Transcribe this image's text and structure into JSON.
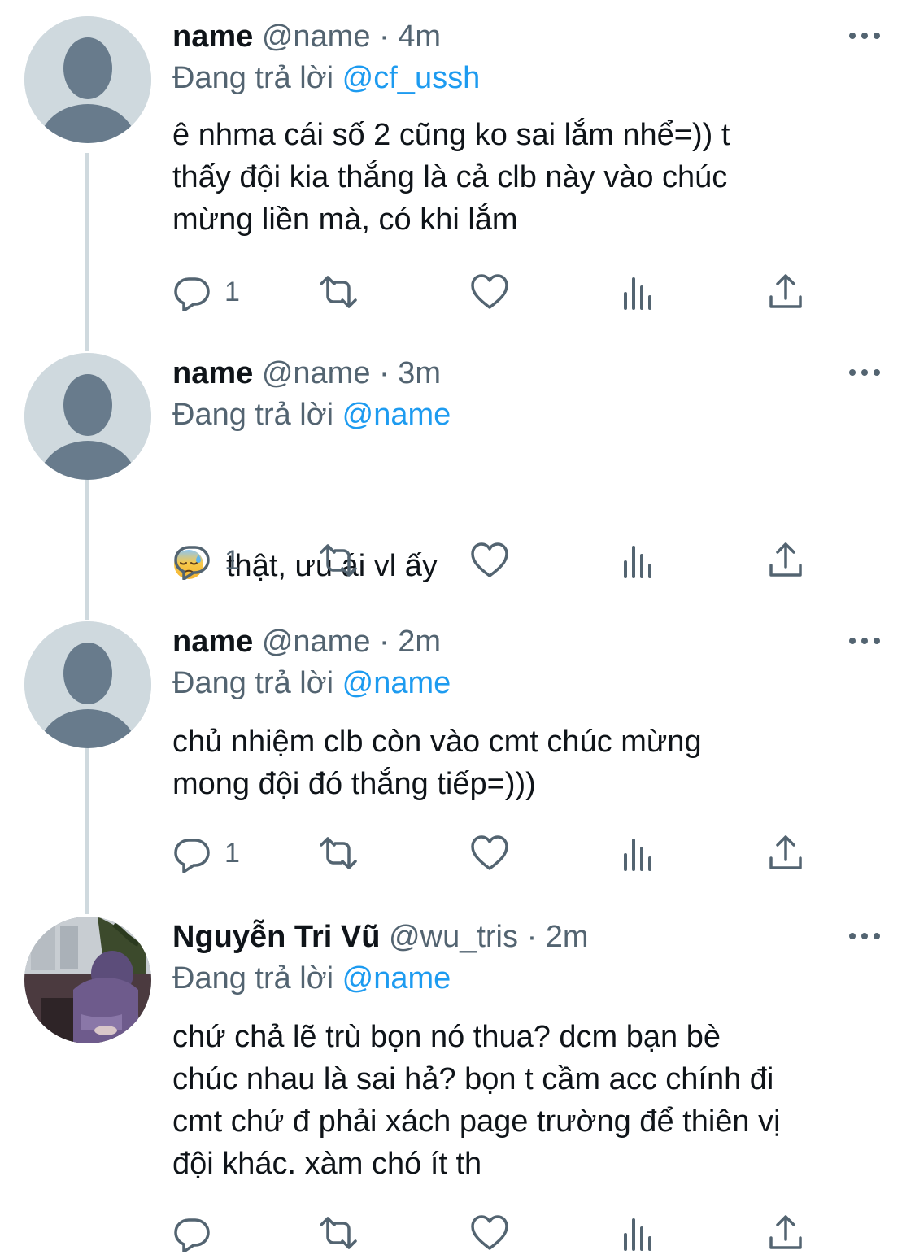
{
  "tweets": [
    {
      "display_name": "name",
      "handle": "@name",
      "separator": "·",
      "time": "4m",
      "reply_prefix": "Đang trả lời",
      "reply_to": "@cf_ussh",
      "text": "ê nhma cái số 2 cũng ko sai lắm nhể=)) t\nthấy đội kia thắng là cả clb này vào chúc\nmừng liền mà, có khi lắm",
      "reply_count": "1",
      "avatar": "default-avatar"
    },
    {
      "display_name": "name",
      "handle": "@name",
      "separator": "·",
      "time": "3m",
      "reply_prefix": "Đang trả lời",
      "reply_to": "@name",
      "emoji": "sweat-face-emoji",
      "text": "thật, ưu ái vl ấy",
      "reply_count": "1",
      "avatar": "default-avatar"
    },
    {
      "display_name": "name",
      "handle": "@name",
      "separator": "·",
      "time": "2m",
      "reply_prefix": "Đang trả lời",
      "reply_to": "@name",
      "text": "chủ nhiệm clb còn vào cmt chúc mừng\nmong đội đó thắng tiếp=)))",
      "reply_count": "1",
      "avatar": "default-avatar"
    },
    {
      "display_name": "Nguyễn Tri Vũ",
      "handle": "@wu_tris",
      "separator": "·",
      "time": "2m",
      "reply_prefix": "Đang trả lời",
      "reply_to": "@name",
      "text": "chứ chả lẽ trù bọn nó thua? dcm bạn bè\nchúc nhau là sai hả? bọn t cầm acc chính đi\ncmt chứ đ phải xách page trường để thiên vị\nđội khác. xàm chó ít th",
      "reply_count": "",
      "avatar": "photo-avatar"
    }
  ],
  "icons": {
    "reply": "reply-icon",
    "retweet": "retweet-icon",
    "like": "like-icon",
    "views": "views-icon",
    "share": "share-icon",
    "more": "more-icon"
  },
  "colors": {
    "text": "#0f1419",
    "secondary": "#536471",
    "accent": "#1d9bf0",
    "thread_line": "#cfd9de",
    "avatar_bg": "#cfd9de",
    "avatar_fg": "#687b8c"
  }
}
